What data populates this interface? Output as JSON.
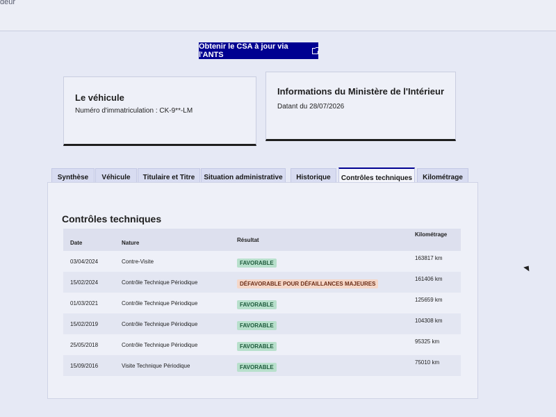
{
  "header": {
    "fragment": "deur"
  },
  "ants_button": {
    "label": "Obtenir le CSA à jour via l'ANTS"
  },
  "vehicle_card": {
    "title": "Le véhicule",
    "registration": "Numéro d'immatriculation : CK-9**-LM"
  },
  "ministry_card": {
    "title": "Informations du Ministère de l'Intérieur",
    "date": "Datant du 28/07/2026"
  },
  "tabs": [
    {
      "label": "Synthèse"
    },
    {
      "label": "Véhicule"
    },
    {
      "label": "Titulaire et Titre"
    },
    {
      "label": "Situation administrative"
    },
    {
      "label": "Historique"
    },
    {
      "label": "Contrôles techniques"
    },
    {
      "label": "Kilométrage"
    }
  ],
  "active_tab": "Contrôles techniques",
  "panel": {
    "title": "Contrôles techniques",
    "columns": {
      "date": "Date",
      "nature": "Nature",
      "result": "Résultat",
      "km": "Kilométrage"
    },
    "rows": [
      {
        "date": "03/04/2024",
        "nature": "Contre-Visite",
        "result": "FAVORABLE",
        "km": "163817 km"
      },
      {
        "date": "15/02/2024",
        "nature": "Contrôle Technique Périodique",
        "result": "DÉFAVORABLE POUR DÉFAILLANCES MAJEURES",
        "km": "161406 km"
      },
      {
        "date": "01/03/2021",
        "nature": "Contrôle Technique Périodique",
        "result": "FAVORABLE",
        "km": "125659 km"
      },
      {
        "date": "15/02/2019",
        "nature": "Contrôle Technique Périodique",
        "result": "FAVORABLE",
        "km": "104308 km"
      },
      {
        "date": "25/05/2018",
        "nature": "Contrôle Technique Périodique",
        "result": "FAVORABLE",
        "km": "95325 km"
      },
      {
        "date": "15/09/2016",
        "nature": "Visite Technique Périodique",
        "result": "FAVORABLE",
        "km": "75010 km"
      }
    ]
  },
  "colors": {
    "primary": "#000091",
    "favorable_bg": "#b8e0cc",
    "defavorable_bg": "#f5d7c8"
  }
}
